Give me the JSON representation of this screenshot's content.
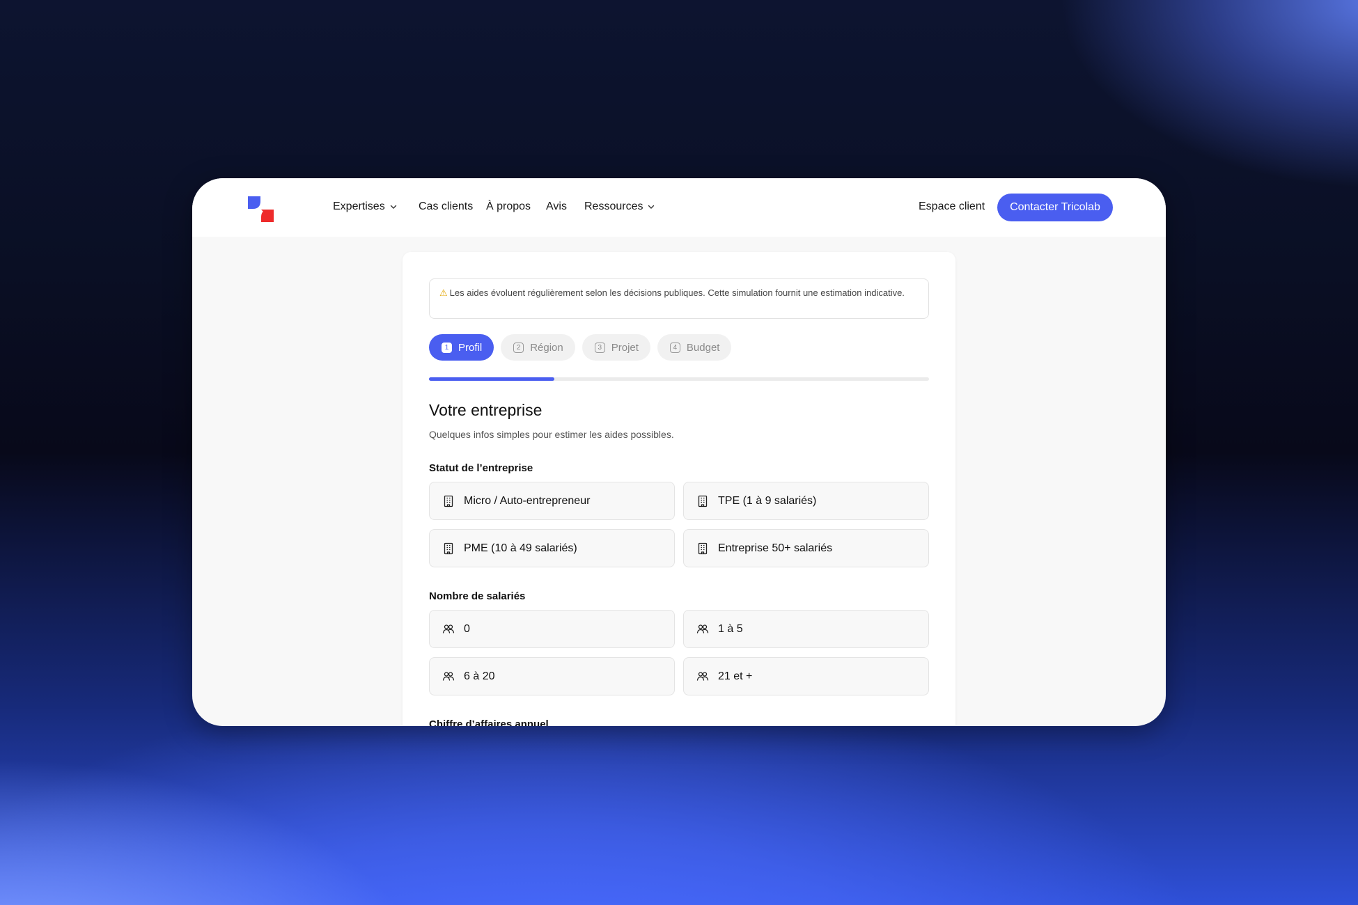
{
  "nav": {
    "items": [
      {
        "label": "Expertises",
        "dropdown": true
      },
      {
        "label": "Cas clients",
        "dropdown": false
      },
      {
        "label": "À propos",
        "dropdown": false
      },
      {
        "label": "Avis",
        "dropdown": false
      },
      {
        "label": "Ressources",
        "dropdown": true
      }
    ],
    "client_link": "Espace client",
    "contact_button": "Contacter Tricolab"
  },
  "notice": {
    "icon": "warning-icon",
    "text": "Les aides évoluent régulièrement selon les décisions publiques. Cette simulation fournit une estimation indicative."
  },
  "steps": [
    {
      "num": "1",
      "label": "Profil",
      "active": true
    },
    {
      "num": "2",
      "label": "Région",
      "active": false
    },
    {
      "num": "3",
      "label": "Projet",
      "active": false
    },
    {
      "num": "4",
      "label": "Budget",
      "active": false
    }
  ],
  "progress": {
    "fraction": 0.25
  },
  "form": {
    "title": "Votre entreprise",
    "subtitle": "Quelques infos simples pour estimer les aides possibles.",
    "status": {
      "label": "Statut de l’entreprise",
      "icon": "building-icon",
      "options": [
        "Micro / Auto-entrepreneur",
        "TPE (1 à 9 salariés)",
        "PME (10 à 49 salariés)",
        "Entreprise 50+ salariés"
      ]
    },
    "employees": {
      "label": "Nombre de salariés",
      "icon": "users-icon",
      "options": [
        "0",
        "1 à 5",
        "6 à 20",
        "21 et +"
      ]
    },
    "revenue": {
      "label": "Chiffre d’affaires annuel"
    }
  },
  "colors": {
    "accent": "#4a5ef0",
    "logo_blue": "#4a5ef0",
    "logo_red": "#ee2b2b",
    "warning": "#e2a400"
  }
}
